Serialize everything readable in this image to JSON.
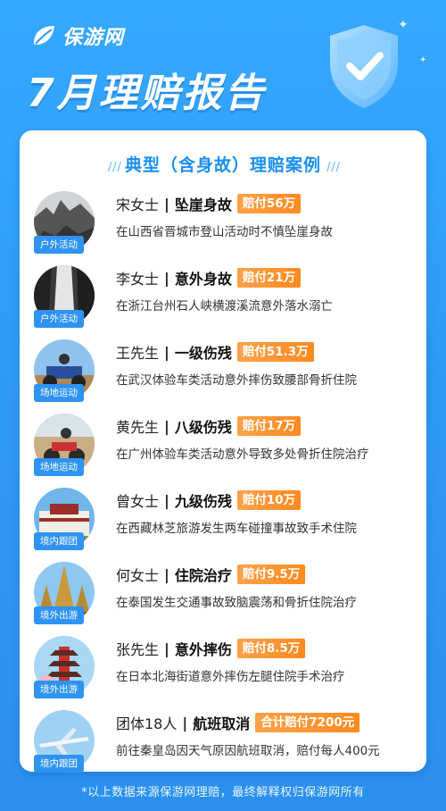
{
  "brand": {
    "name": "保游网"
  },
  "page_title": "7月理赔报告",
  "section_title": "典型（含身故）理赔案例",
  "colors": {
    "background": "#2f9bf6",
    "accent_blue": "#2e93f2",
    "payout_orange": "#ff8a1f"
  },
  "cases": [
    {
      "name": "宋女士",
      "accident": "坠崖身故",
      "payout": "赔付56万",
      "detail": "在山西省晋城市登山活动时不慎坠崖身故",
      "category": "户外活动",
      "thumb_icon": "cliff-photo-icon"
    },
    {
      "name": "李女士",
      "accident": "意外身故",
      "payout": "赔付21万",
      "detail": "在浙江台州石人峡横渡溪流意外落水溺亡",
      "category": "户外活动",
      "thumb_icon": "waterfall-photo-icon"
    },
    {
      "name": "王先生",
      "accident": "一级伤残",
      "payout": "赔付51.3万",
      "detail": "在武汉体验车类活动意外摔伤致腰部骨折住院",
      "category": "场地运动",
      "thumb_icon": "atv-photo-icon"
    },
    {
      "name": "黄先生",
      "accident": "八级伤残",
      "payout": "赔付17万",
      "detail": "在广州体验车类活动意外导致多处骨折住院治疗",
      "category": "场地运动",
      "thumb_icon": "motorbike-photo-icon"
    },
    {
      "name": "曾女士",
      "accident": "九级伤残",
      "payout": "赔付10万",
      "detail": "在西藏林芝旅游发生两车碰撞事故致手术住院",
      "category": "境内跟团",
      "thumb_icon": "palace-photo-icon"
    },
    {
      "name": "何女士",
      "accident": "住院治疗",
      "payout": "赔付9.5万",
      "detail": "在泰国发生交通事故致脑震荡和骨折住院治疗",
      "category": "境外出游",
      "thumb_icon": "temple-photo-icon"
    },
    {
      "name": "张先生",
      "accident": "意外摔伤",
      "payout": "赔付8.5万",
      "detail": "在日本北海街道意外摔伤左腿住院手术治疗",
      "category": "境外出游",
      "thumb_icon": "pagoda-photo-icon"
    },
    {
      "name": "团体18人",
      "accident": "航班取消",
      "payout": "合计赔付7200元",
      "detail": "前往秦皇岛因天气原因航班取消，赔付每人400元",
      "category": "境内跟团",
      "thumb_icon": "airplane-photo-icon"
    }
  ],
  "footer_note": "*以上数据来源保游网理赔，最终解释权归保游网所有"
}
